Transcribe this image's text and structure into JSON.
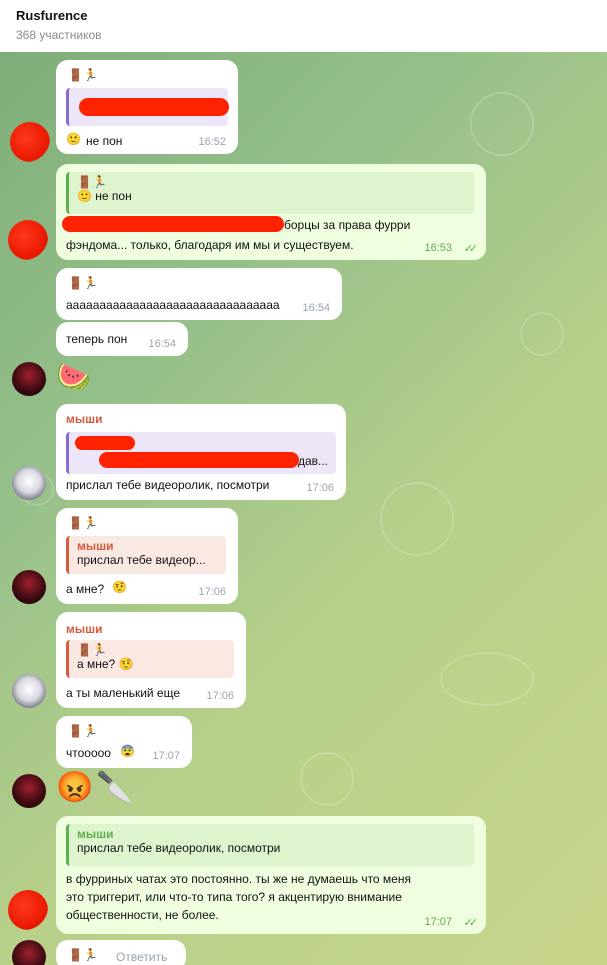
{
  "header": {
    "title": "Rusfurence",
    "subtitle": "368 участников"
  },
  "messages": {
    "m1": {
      "header_icons": "🚪🏃",
      "text": "не пон",
      "emoji": "🙂",
      "time": "16:52"
    },
    "m2": {
      "reply_icons": "🚪🏃",
      "reply_text": "не пон",
      "reply_emoji": "🙂",
      "text_line1": "борцы за права фурри",
      "text_line2": "фэндома... только, благодаря им мы и существуем.",
      "time": "16:53"
    },
    "m3": {
      "header_icons": "🚪🏃",
      "text": "аааааааааааааааааааааааааааааааа",
      "time": "16:54"
    },
    "m4": {
      "text": "теперь пон",
      "time": "16:54"
    },
    "m5": {
      "emoji": "🍉"
    },
    "m6": {
      "sender": "мыши",
      "reply_suffix": "дав...",
      "text": "прислал тебе видеоролик, посмотри",
      "time": "17:06"
    },
    "m7": {
      "header_icons": "🚪🏃",
      "reply_name": "мыши",
      "reply_text": "прислал тебе видеор...",
      "text": "а мне?",
      "emoji": "🤨",
      "time": "17:06"
    },
    "m8": {
      "sender": "мыши",
      "reply_icons": "🚪🏃",
      "reply_text": "а мне?",
      "reply_emoji": "🤨",
      "text": "а ты маленький еще",
      "time": "17:06"
    },
    "m9": {
      "header_icons": "🚪🏃",
      "text": "чтоoooo",
      "emoji": "😨",
      "time": "17:07"
    },
    "m10": {
      "emoji1": "😡",
      "emoji2": "🔪"
    },
    "m11": {
      "reply_name": "мыши",
      "reply_text": "прислал тебе видеоролик, посмотри",
      "text_line1": "в фурриных чатах это постоянно. ты же не думаешь что меня",
      "text_line2": "это триггерит, или что-то типа того? я акцентирую внимание",
      "text_line3": "общественности, не более.",
      "time": "17:07"
    },
    "m12": {
      "header_icons": "🚪🏃",
      "action": "Ответить"
    }
  },
  "colors": {
    "outgoing_bubble": "#eefedf",
    "incoming_bubble": "#ffffff",
    "accent_green": "#5eaf4e",
    "accent_red": "#d75b3a",
    "scribble": "#ff2200"
  }
}
